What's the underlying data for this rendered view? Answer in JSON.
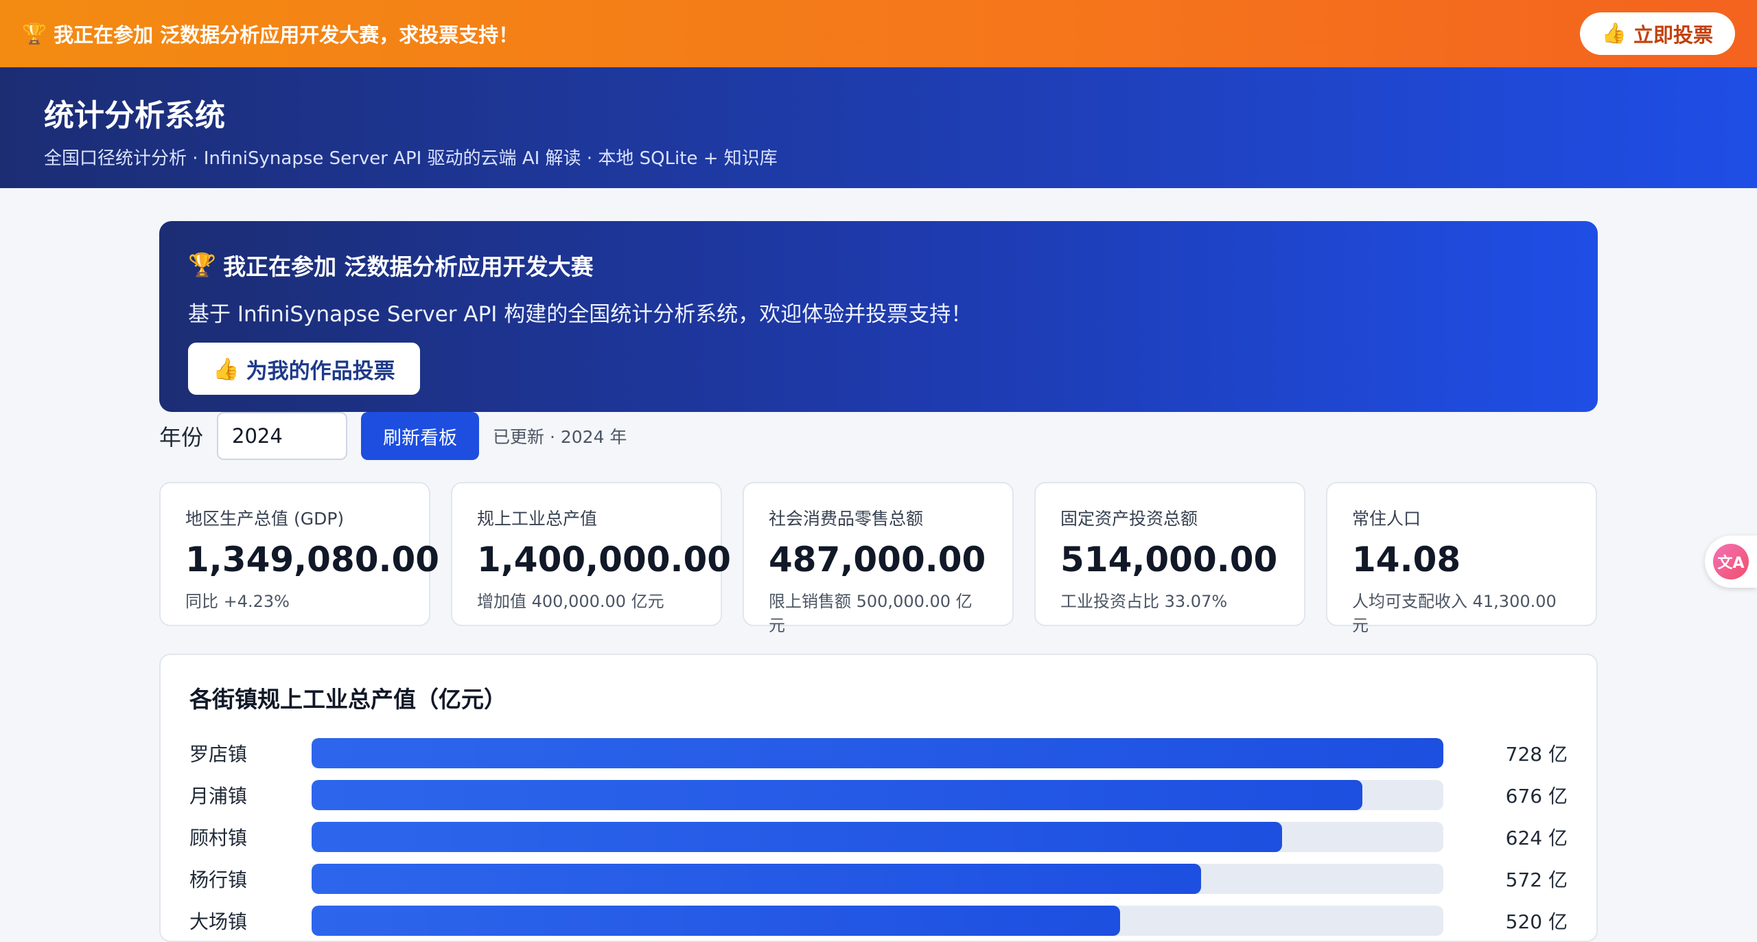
{
  "promo_bar": {
    "icon": "trophy-icon",
    "text": "我正在参加 泛数据分析应用开发大赛，求投票支持！",
    "vote_button_icon": "thumbs-up-icon",
    "vote_button_label": "立即投票"
  },
  "header": {
    "title": "统计分析系统",
    "subtitle": "全国口径统计分析 · InfiniSynapse Server API 驱动的云端 AI 解读 · 本地 SQLite + 知识库"
  },
  "contest_banner": {
    "icon": "trophy-icon",
    "title": "我正在参加 泛数据分析应用开发大赛",
    "description": "基于 InfiniSynapse Server API 构建的全国统计分析系统，欢迎体验并投票支持！",
    "button_icon": "thumbs-up-icon",
    "button_label": "为我的作品投票"
  },
  "controls": {
    "year_label": "年份",
    "year_value": "2024",
    "refresh_label": "刷新看板",
    "status": "已更新 · 2024 年"
  },
  "cards": [
    {
      "label": "地区生产总值 (GDP)",
      "value": "1,349,080.00",
      "sub": "同比 +4.23%"
    },
    {
      "label": "规上工业总产值",
      "value": "1,400,000.00",
      "sub": "增加值 400,000.00 亿元"
    },
    {
      "label": "社会消费品零售总额",
      "value": "487,000.00",
      "sub": "限上销售额 500,000.00 亿元"
    },
    {
      "label": "固定资产投资总额",
      "value": "514,000.00",
      "sub": "工业投资占比 33.07%"
    },
    {
      "label": "常住人口",
      "value": "14.08",
      "sub": "人均可支配收入 41,300.00 元"
    }
  ],
  "chart": {
    "title": "各街镇规上工业总产值（亿元）",
    "unit_suffix": " 亿",
    "max": 728,
    "rows": [
      {
        "name": "罗店镇",
        "value": 728,
        "value_label": "728 亿"
      },
      {
        "name": "月浦镇",
        "value": 676,
        "value_label": "676 亿"
      },
      {
        "name": "顾村镇",
        "value": 624,
        "value_label": "624 亿"
      },
      {
        "name": "杨行镇",
        "value": 572,
        "value_label": "572 亿"
      },
      {
        "name": "大场镇",
        "value": 520,
        "value_label": "520 亿"
      }
    ]
  },
  "translate_fab": {
    "icon": "translate-icon",
    "glyph": "文A"
  },
  "colors": {
    "promo_orange": "#f5761b",
    "header_navy": "#1c2d74",
    "accent_blue": "#1d4ee0"
  }
}
